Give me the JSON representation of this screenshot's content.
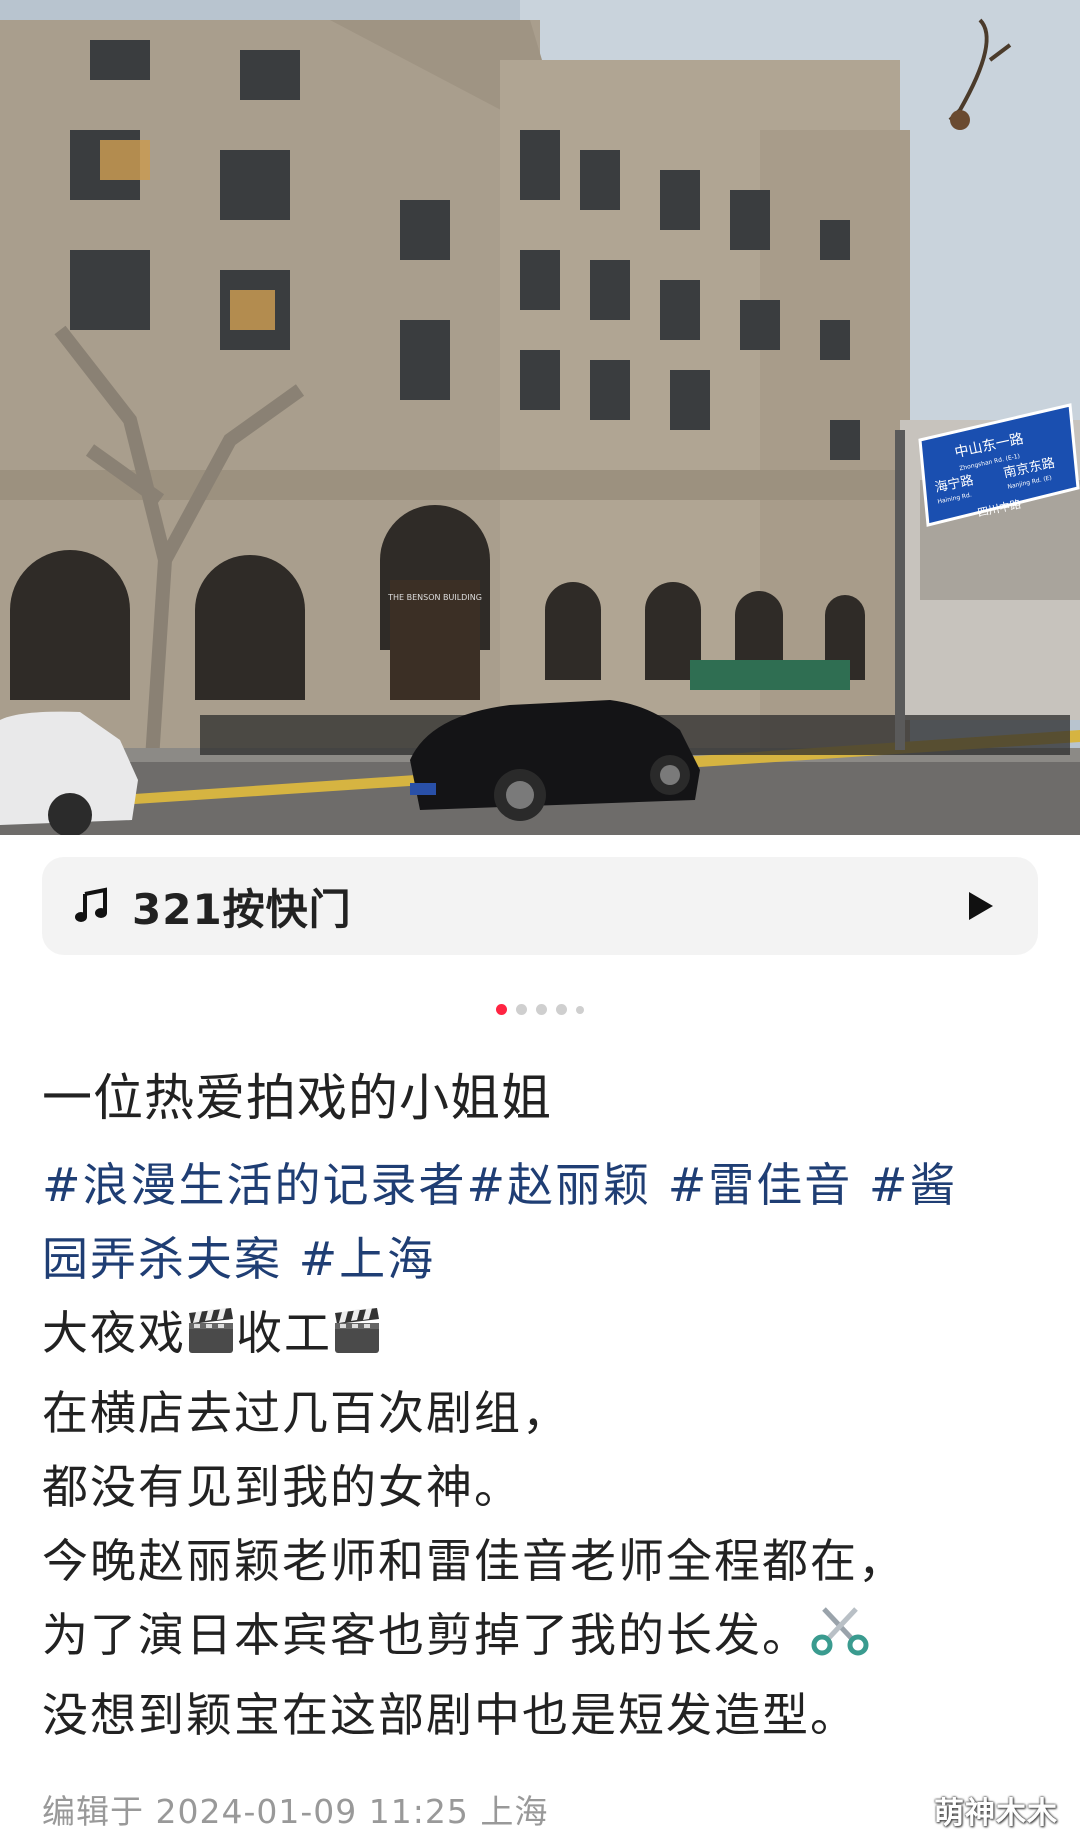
{
  "photo": {
    "sign_line1": "中山东一路",
    "sign_line1_en": "Zhongshan Rd. (E-1)",
    "sign_left": "海宁路",
    "sign_left_en": "Haining Rd.",
    "sign_right": "南京东路",
    "sign_right_en": "Nanjing Rd. (E)",
    "sign_bottom": "四川中路",
    "building_name": "THE BENSON BUILDING"
  },
  "music": {
    "label": "321按快门"
  },
  "carousel": {
    "count": 5,
    "active": 0
  },
  "post": {
    "title": "一位热爱拍戏的小姐姐",
    "tags_line1": "#浪漫生活的记录者#赵丽颖 #雷佳音 #酱",
    "tags_line2": "园弄杀夫案 #上海",
    "line1_a": "大夜戏",
    "line1_b": "收工",
    "line2": "在横店去过几百次剧组，",
    "line3": "都没有见到我的女神。",
    "line4": "今晚赵丽颖老师和雷佳音老师全程都在，",
    "line5": "为了演日本宾客也剪掉了我的长发。",
    "line6": "没想到颖宝在这部剧中也是短发造型。"
  },
  "footer": {
    "edited": "编辑于 2024-01-09 11:25 上海"
  },
  "watermark": "萌神木木",
  "colors": {
    "tag": "#1f3e74",
    "dot_active": "#ff2442",
    "music_bg": "#f3f3f3"
  },
  "icons": [
    "music-note-icon",
    "play-icon",
    "clapper-board-icon",
    "scissors-icon"
  ]
}
